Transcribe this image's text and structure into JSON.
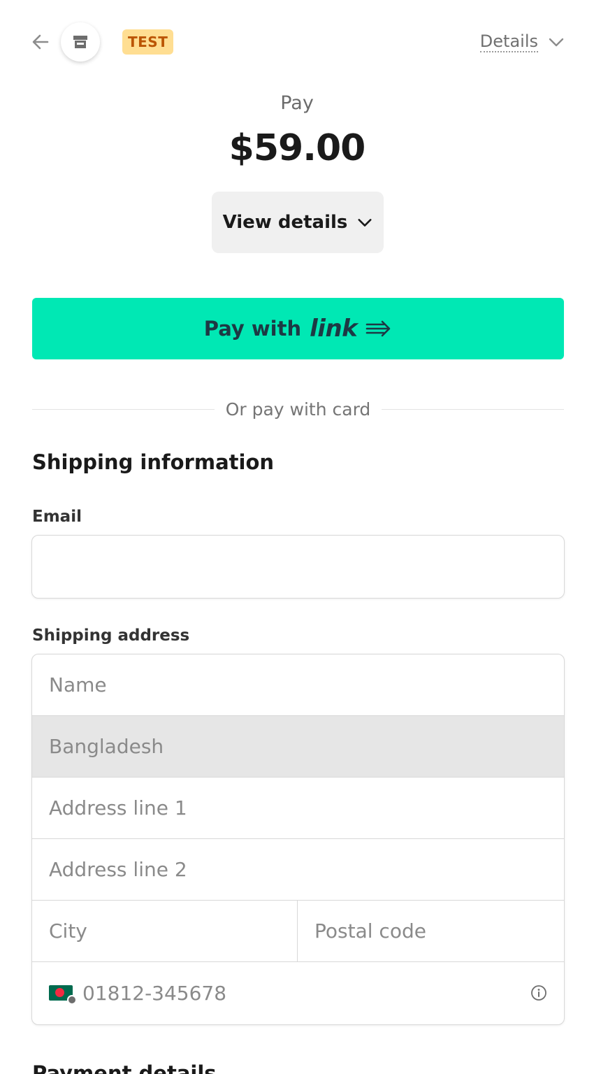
{
  "header": {
    "test_badge": "TEST",
    "details_label": "Details"
  },
  "summary": {
    "pay_label": "Pay",
    "amount": "$59.00",
    "view_details_label": "View details"
  },
  "link_button": {
    "prefix": "Pay with",
    "brand": "link",
    "accent_color": "#00e8b4"
  },
  "divider_text": "Or pay with card",
  "shipping": {
    "title": "Shipping information",
    "email_label": "Email",
    "email_value": "",
    "address_label": "Shipping address",
    "name_placeholder": "Name",
    "country_value": "Bangladesh",
    "address1_placeholder": "Address line 1",
    "address2_placeholder": "Address line 2",
    "city_placeholder": "City",
    "postal_placeholder": "Postal code",
    "phone_placeholder": "01812-345678"
  },
  "next_section_title": "Payment details",
  "icons": {
    "back": "back-arrow-icon",
    "store": "store-icon",
    "chevron": "chevron-down-icon",
    "link_arrow": "link-arrow-icon",
    "flag": "bangladesh-flag-icon",
    "info": "info-icon"
  }
}
